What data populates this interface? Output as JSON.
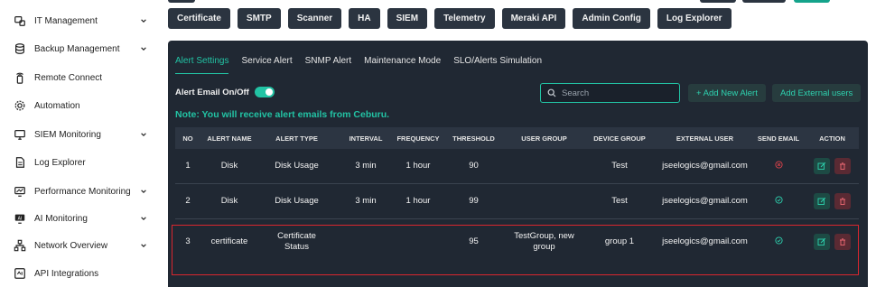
{
  "sidebar": {
    "items": [
      {
        "label": "IT Management",
        "icon": "it-management-icon",
        "expandable": true
      },
      {
        "label": "Backup Management",
        "icon": "database-icon",
        "expandable": true
      },
      {
        "label": "Remote Connect",
        "icon": "remote-icon",
        "expandable": false
      },
      {
        "label": "Automation",
        "icon": "gear-icon",
        "expandable": false
      },
      {
        "label": "SIEM Monitoring",
        "icon": "siem-icon",
        "expandable": true
      },
      {
        "label": "Log Explorer",
        "icon": "document-icon",
        "expandable": false
      },
      {
        "label": "Performance Monitoring",
        "icon": "monitor-icon",
        "expandable": true
      },
      {
        "label": "AI Monitoring",
        "icon": "ai-icon",
        "expandable": true
      },
      {
        "label": "Network Overview",
        "icon": "network-icon",
        "expandable": true
      },
      {
        "label": "API Integrations",
        "icon": "api-icon",
        "expandable": false
      }
    ]
  },
  "top_buttons": [
    "Certificate",
    "SMTP",
    "Scanner",
    "HA",
    "SIEM",
    "Telemetry",
    "Meraki API",
    "Admin Config",
    "Log Explorer"
  ],
  "tabs": [
    {
      "label": "Alert Settings",
      "active": true
    },
    {
      "label": "Service Alert",
      "active": false
    },
    {
      "label": "SNMP Alert",
      "active": false
    },
    {
      "label": "Maintenance Mode",
      "active": false
    },
    {
      "label": "SLO/Alerts Simulation",
      "active": false
    }
  ],
  "alert_email_label": "Alert Email On/Off",
  "alert_email_on": true,
  "note": "Note: You will receive alert emails from Ceburu.",
  "search": {
    "placeholder": "Search",
    "value": ""
  },
  "buttons": {
    "add_new_alert": "+ Add New Alert",
    "add_external_users": "Add External users"
  },
  "table": {
    "headers": [
      "NO",
      "ALERT NAME",
      "ALERT TYPE",
      "INTERVAL",
      "FREQUENCY",
      "THRESHOLD",
      "USER GROUP",
      "DEVICE GROUP",
      "EXTERNAL USER",
      "SEND EMAIL",
      "ACTION"
    ],
    "rows": [
      {
        "no": "1",
        "name": "Disk",
        "type": "Disk Usage",
        "interval": "3 min",
        "frequency": "1 hour",
        "threshold": "90",
        "user_group": "",
        "device_group": "Test",
        "external_user": "jseelogics@gmail.com",
        "send_email": "off"
      },
      {
        "no": "2",
        "name": "Disk",
        "type": "Disk Usage",
        "interval": "3 min",
        "frequency": "1 hour",
        "threshold": "99",
        "user_group": "",
        "device_group": "Test",
        "external_user": "jseelogics@gmail.com",
        "send_email": "on"
      },
      {
        "no": "3",
        "name": "certificate",
        "type": "Certificate Status",
        "interval": "",
        "frequency": "",
        "threshold": "95",
        "user_group": "TestGroup, new group",
        "device_group": "group 1",
        "external_user": "jseelogics@gmail.com",
        "send_email": "on"
      }
    ]
  },
  "colors": {
    "accent": "#22c3a4",
    "panel": "#202833",
    "danger": "#d9262e",
    "status_off": "#e0434b"
  }
}
